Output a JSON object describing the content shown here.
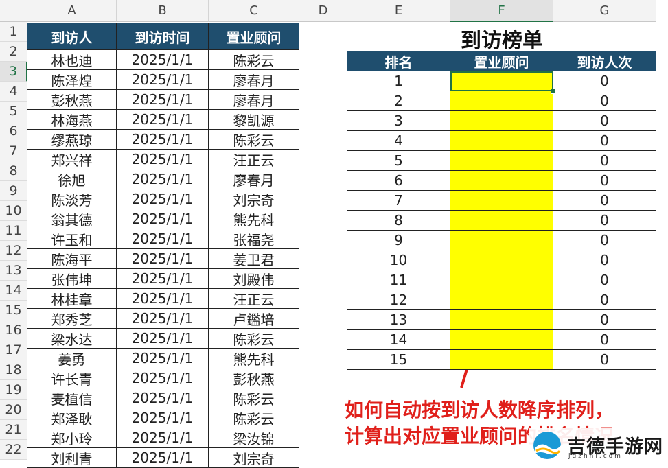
{
  "columns": [
    "A",
    "B",
    "C",
    "D",
    "E",
    "F",
    "G"
  ],
  "active_column": "F",
  "active_row": "3",
  "rows": [
    "1",
    "2",
    "3",
    "4",
    "5",
    "6",
    "7",
    "8",
    "9",
    "10",
    "11",
    "12",
    "13",
    "14",
    "15",
    "16",
    "17",
    "18",
    "19",
    "20",
    "21",
    "22"
  ],
  "visit_table": {
    "headers": [
      "到访人",
      "到访时间",
      "置业顾问"
    ],
    "records": [
      [
        "林也迪",
        "2025/1/1",
        "陈彩云"
      ],
      [
        "陈泽煌",
        "2025/1/1",
        "廖春月"
      ],
      [
        "彭秋燕",
        "2025/1/1",
        "廖春月"
      ],
      [
        "林海燕",
        "2025/1/1",
        "黎凯源"
      ],
      [
        "缪燕琼",
        "2025/1/1",
        "陈彩云"
      ],
      [
        "郑兴祥",
        "2025/1/1",
        "汪正云"
      ],
      [
        "徐旭",
        "2025/1/1",
        "廖春月"
      ],
      [
        "陈淡芳",
        "2025/1/1",
        "刘宗奇"
      ],
      [
        "翁其德",
        "2025/1/1",
        "熊先科"
      ],
      [
        "许玉和",
        "2025/1/1",
        "张福尧"
      ],
      [
        "陈海平",
        "2025/1/1",
        "姜卫君"
      ],
      [
        "张伟坤",
        "2025/1/1",
        "刘殿伟"
      ],
      [
        "林桂章",
        "2025/1/1",
        "汪正云"
      ],
      [
        "郑秀芝",
        "2025/1/1",
        "卢鑑培"
      ],
      [
        "梁水达",
        "2025/1/1",
        "陈彩云"
      ],
      [
        "姜勇",
        "2025/1/1",
        "熊先科"
      ],
      [
        "许长青",
        "2025/1/1",
        "彭秋燕"
      ],
      [
        "麦植信",
        "2025/1/1",
        "陈彩云"
      ],
      [
        "郑泽耿",
        "2025/1/1",
        "陈彩云"
      ],
      [
        "郑小玲",
        "2025/1/1",
        "梁汝锦"
      ],
      [
        "刘利青",
        "2025/1/1",
        "刘宗奇"
      ]
    ]
  },
  "ranking": {
    "title": "到访榜单",
    "headers": [
      "排名",
      "置业顾问",
      "到访人次"
    ],
    "rows": [
      [
        "1",
        "",
        "0"
      ],
      [
        "2",
        "",
        "0"
      ],
      [
        "3",
        "",
        "0"
      ],
      [
        "4",
        "",
        "0"
      ],
      [
        "5",
        "",
        "0"
      ],
      [
        "6",
        "",
        "0"
      ],
      [
        "7",
        "",
        "0"
      ],
      [
        "8",
        "",
        "0"
      ],
      [
        "9",
        "",
        "0"
      ],
      [
        "10",
        "",
        "0"
      ],
      [
        "11",
        "",
        "0"
      ],
      [
        "12",
        "",
        "0"
      ],
      [
        "13",
        "",
        "0"
      ],
      [
        "14",
        "",
        "0"
      ],
      [
        "15",
        "",
        "0"
      ]
    ]
  },
  "annotation": {
    "line1": "如何自动按到访人数降序排列，",
    "line2": "计算出对应置业顾问的排名情况",
    "arrow_color": "#e0201b"
  },
  "watermark": {
    "name": "吉德手游网",
    "domain": "jdzhnl.com"
  },
  "colors": {
    "header_bg": "#1f4e6e",
    "highlight": "#ffff00",
    "excel_green": "#217346"
  }
}
